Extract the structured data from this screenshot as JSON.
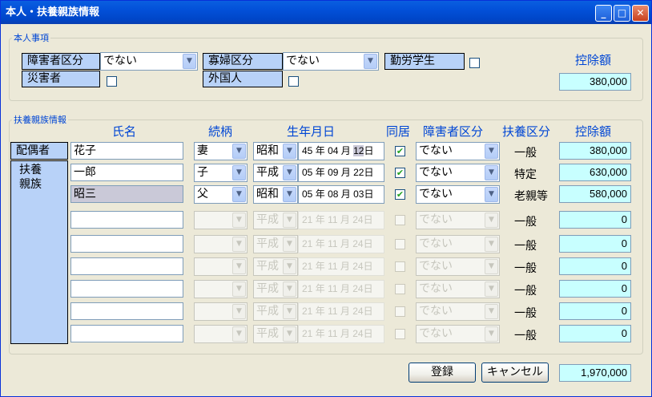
{
  "window": {
    "title": "本人・扶養親族情報"
  },
  "self": {
    "group_title": "本人事項",
    "disability_label": "障害者区分",
    "disability_value": "でない",
    "widow_label": "寡婦区分",
    "widow_value": "でない",
    "working_student_label": "勤労学生",
    "working_student_checked": false,
    "disaster_label": "災害者",
    "disaster_checked": false,
    "foreigner_label": "外国人",
    "foreigner_checked": false,
    "deduction_label": "控除額",
    "deduction_amount": "380,000"
  },
  "dependents": {
    "group_title": "扶養親族情報",
    "headers": {
      "name": "氏名",
      "relation": "続柄",
      "birthdate": "生年月日",
      "cohabit": "同居",
      "disability": "障害者区分",
      "category": "扶養区分",
      "deduction": "控除額"
    },
    "spouse_label": "配偶者",
    "dependent_label": "扶養\n親族",
    "rows": [
      {
        "name": "花子",
        "relation": "妻",
        "era": "昭和",
        "date_y": "45",
        "date_m": "04",
        "date_d": "12",
        "cohabit": true,
        "disability": "でない",
        "category": "一般",
        "amount": "380,000",
        "enabled": true
      },
      {
        "name": "一郎",
        "relation": "子",
        "era": "平成",
        "date_y": "05",
        "date_m": "09",
        "date_d": "22",
        "cohabit": true,
        "disability": "でない",
        "category": "特定",
        "amount": "630,000",
        "enabled": true
      },
      {
        "name": "昭三",
        "relation": "父",
        "era": "昭和",
        "date_y": "05",
        "date_m": "08",
        "date_d": "03",
        "cohabit": true,
        "disability": "でない",
        "category": "老親等",
        "amount": "580,000",
        "enabled": true
      },
      {
        "name": "",
        "relation": "",
        "era": "平成",
        "date_y": "21",
        "date_m": "11",
        "date_d": "24",
        "cohabit": false,
        "disability": "でない",
        "category": "一般",
        "amount": "0",
        "enabled": false
      },
      {
        "name": "",
        "relation": "",
        "era": "平成",
        "date_y": "21",
        "date_m": "11",
        "date_d": "24",
        "cohabit": false,
        "disability": "でない",
        "category": "一般",
        "amount": "0",
        "enabled": false
      },
      {
        "name": "",
        "relation": "",
        "era": "平成",
        "date_y": "21",
        "date_m": "11",
        "date_d": "24",
        "cohabit": false,
        "disability": "でない",
        "category": "一般",
        "amount": "0",
        "enabled": false
      },
      {
        "name": "",
        "relation": "",
        "era": "平成",
        "date_y": "21",
        "date_m": "11",
        "date_d": "24",
        "cohabit": false,
        "disability": "でない",
        "category": "一般",
        "amount": "0",
        "enabled": false
      },
      {
        "name": "",
        "relation": "",
        "era": "平成",
        "date_y": "21",
        "date_m": "11",
        "date_d": "24",
        "cohabit": false,
        "disability": "でない",
        "category": "一般",
        "amount": "0",
        "enabled": false
      },
      {
        "name": "",
        "relation": "",
        "era": "平成",
        "date_y": "21",
        "date_m": "11",
        "date_d": "24",
        "cohabit": false,
        "disability": "でない",
        "category": "一般",
        "amount": "0",
        "enabled": false
      }
    ],
    "date_units": {
      "year": "年",
      "month": "月",
      "day": "日"
    }
  },
  "footer": {
    "register_label": "登録",
    "cancel_label": "キャンセル",
    "total_amount": "1,970,000"
  },
  "colors": {
    "label_bg": "#b8d2f8",
    "amount_bg": "#c8ffff",
    "header_text": "#0046d5",
    "titlebar": "#0250d8"
  }
}
